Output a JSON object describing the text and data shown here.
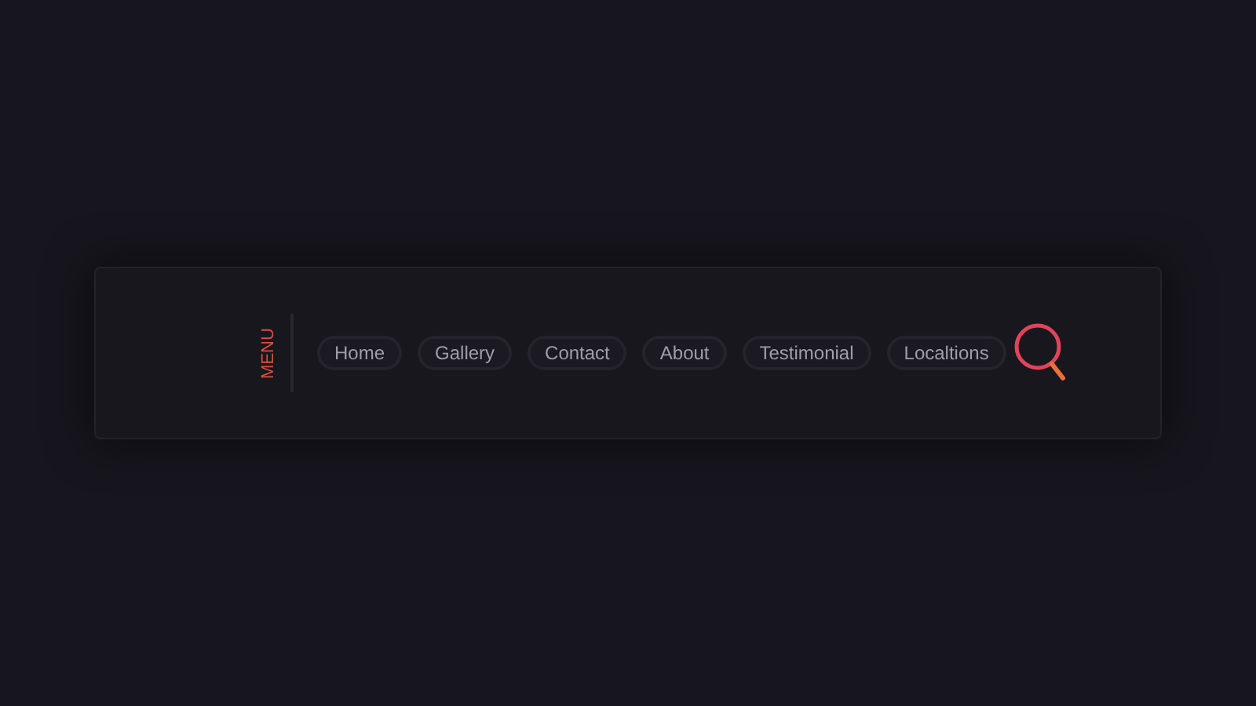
{
  "menu_label": "MENU",
  "nav_items": [
    {
      "label": "Home"
    },
    {
      "label": "Gallery"
    },
    {
      "label": "Contact"
    },
    {
      "label": "About"
    },
    {
      "label": "Testimonial"
    },
    {
      "label": "Localtions"
    }
  ]
}
